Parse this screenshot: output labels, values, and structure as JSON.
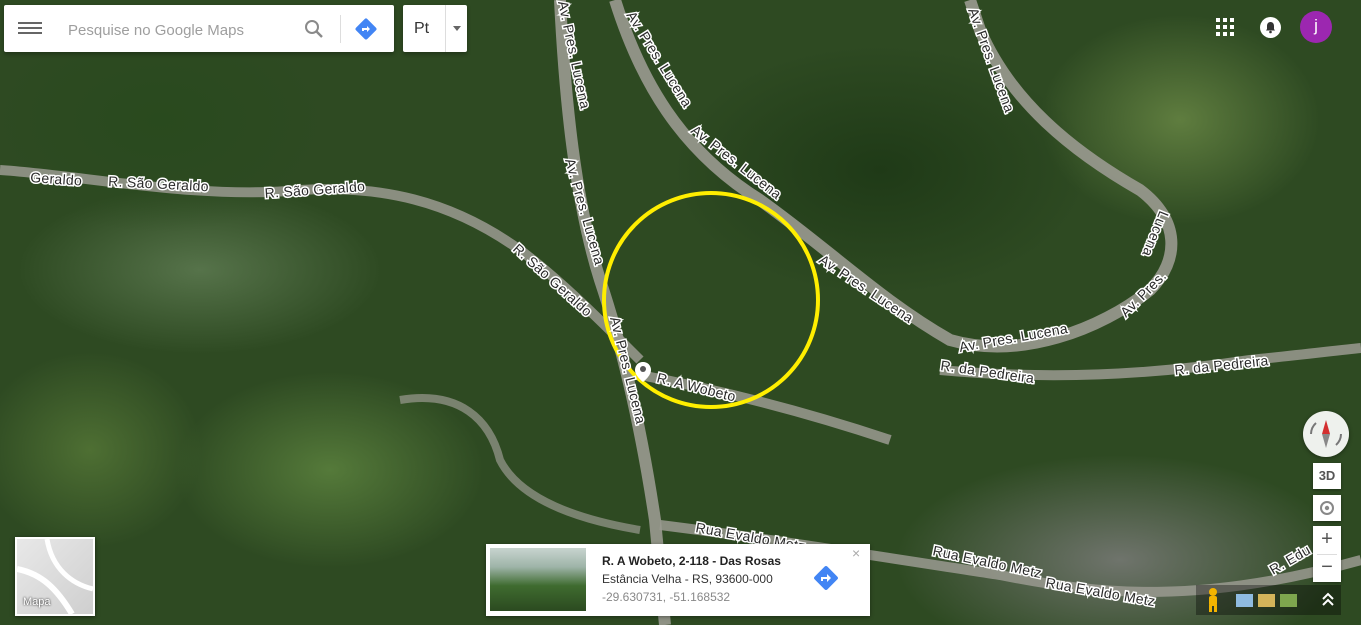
{
  "search": {
    "placeholder": "Pesquise no Google Maps"
  },
  "language": {
    "selected": "Pt"
  },
  "account": {
    "avatar_letter": "j",
    "avatar_color": "#9c27b0"
  },
  "map": {
    "road_labels": {
      "sao_geraldo_1": "Geraldo",
      "sao_geraldo_2": "R. São Geraldo",
      "sao_geraldo_3": "R. São Geraldo",
      "sao_geraldo_4": "R. São Geraldo",
      "lucena_1": "Av. Pres. Lucena",
      "lucena_2": "Av. Pres. Lucena",
      "lucena_3": "Av. Pres. Lucena",
      "lucena_4": "Av. Pres. Lucena",
      "lucena_5": "Av. Pres. Lucena",
      "lucena_6": "Av. Pres. Lucena",
      "lucena_7": "Av. Pres. Lucena",
      "lucena_8": "Lucena",
      "lucena_9": "Av. Pres.",
      "lucena_10": "Av. Pres. Lucena",
      "pedreira_1": "R. da Pedreira",
      "pedreira_2": "R. da Pedreira",
      "wobeto": "R. A Wobeto",
      "evaldo_1": "Rua Evaldo Metz",
      "evaldo_2": "Rua Evaldo Metz",
      "evaldo_3": "Rua Evaldo Metz",
      "edu": "R. Edu"
    },
    "highlight_color": "#ffee00"
  },
  "layer_toggle": {
    "label": "Mapa"
  },
  "info_card": {
    "title": "R. A Wobeto, 2-118 - Das Rosas",
    "address": "Estância Velha - RS, 93600-000",
    "coordinates": "-29.630731, -51.168532",
    "close_label": "×"
  },
  "controls": {
    "tilt_label": "3D",
    "zoom_in": "+",
    "zoom_out": "−",
    "expand_label": "⌃"
  },
  "colors": {
    "directions_blue": "#4285f4",
    "compass_red": "#d32f2f"
  }
}
